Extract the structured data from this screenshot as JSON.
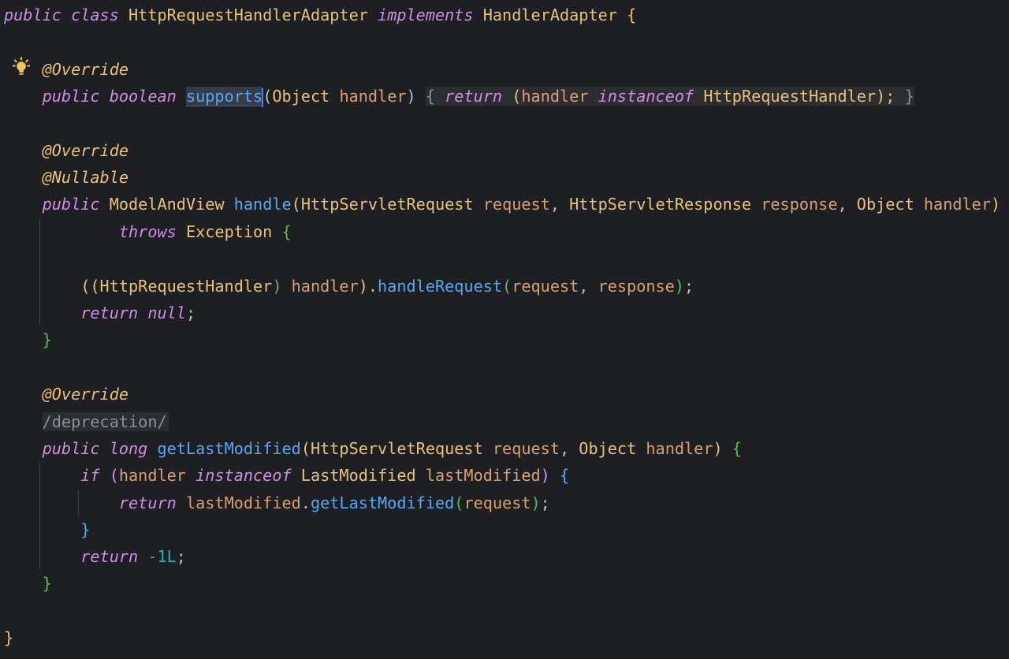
{
  "code": {
    "l1": {
      "kw1": "public",
      "kw2": "class",
      "name": "HttpRequestHandlerAdapter",
      "kw3": "implements",
      "iface": "HandlerAdapter",
      "brace": "{"
    },
    "l2": {
      "ann": "@Override"
    },
    "l3": {
      "kw1": "public",
      "kw2": "boolean",
      "method": "supports",
      "open": "(",
      "type": "Object",
      "param": "handler",
      "close": ")",
      "lb": "{",
      "ret": "return",
      "p_open": "(",
      "var": "handler",
      "inst": "instanceof",
      "type2": "HttpRequestHandler",
      "p_close": ");",
      "rb": "}"
    },
    "l4": {
      "ann": "@Override"
    },
    "l5": {
      "ann": "@Nullable"
    },
    "l6": {
      "kw1": "public",
      "type": "ModelAndView",
      "method": "handle",
      "open": "(",
      "t1": "HttpServletRequest",
      "p1": "request",
      "c1": ",",
      "t2": "HttpServletResponse",
      "p2": "response",
      "c2": ",",
      "t3": "Object",
      "p3": "handler",
      "close": ")"
    },
    "l7": {
      "kw": "throws",
      "type": "Exception",
      "brace": "{"
    },
    "l8": {
      "open2": "((",
      "type": "HttpRequestHandler",
      "close1": ")",
      "var": "handler",
      "close2": ").",
      "method": "handleRequest",
      "open": "(",
      "a1": "request",
      "comma": ",",
      "a2": "response",
      "close": ")",
      "semi": ";"
    },
    "l9": {
      "kw": "return",
      "val": "null",
      "semi": ";"
    },
    "l10": {
      "brace": "}"
    },
    "l11": {
      "ann": "@Override"
    },
    "l12": {
      "comment": "/deprecation/"
    },
    "l13": {
      "kw1": "public",
      "kw2": "long",
      "method": "getLastModified",
      "open": "(",
      "t1": "HttpServletRequest",
      "p1": "request",
      "comma": ",",
      "t2": "Object",
      "p2": "handler",
      "close": ")",
      "brace": "{"
    },
    "l14": {
      "kw": "if",
      "open": "(",
      "var": "handler",
      "inst": "instanceof",
      "type": "LastModified",
      "var2": "lastModified",
      "close": ")",
      "brace": "{"
    },
    "l15": {
      "kw": "return",
      "var": "lastModified",
      "dot": ".",
      "method": "getLastModified",
      "open": "(",
      "arg": "request",
      "close": ")",
      "semi": ";"
    },
    "l16": {
      "brace": "}"
    },
    "l17": {
      "kw": "return",
      "num": "-1L",
      "semi": ";"
    },
    "l18": {
      "brace": "}"
    },
    "l19": {
      "brace": "}"
    }
  },
  "icons": {
    "intention": "lightbulb-icon"
  },
  "colors": {
    "background": "#1e1f22",
    "keyword": "#cf8ee5",
    "class": "#e8c27a",
    "method": "#56a8f5",
    "parameter": "#d9a072",
    "text": "#bcbec4",
    "caret": "#3d7ef0"
  }
}
